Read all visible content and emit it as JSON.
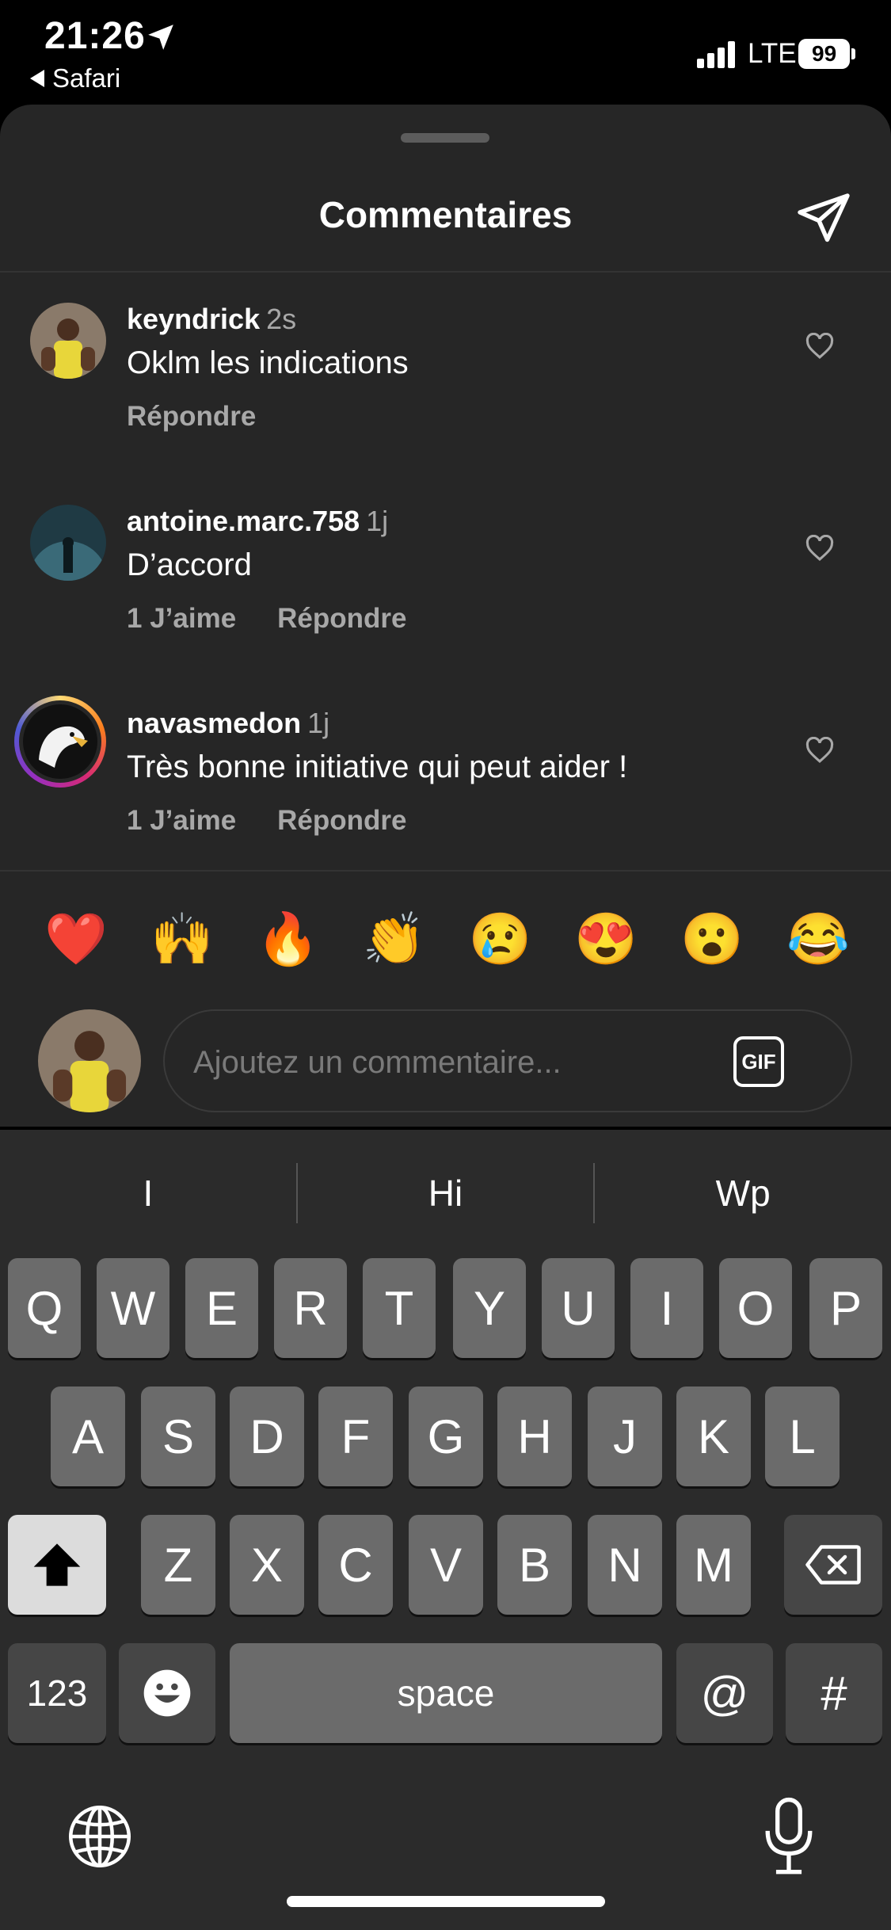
{
  "status_bar": {
    "time": "21:26",
    "back_app": "Safari",
    "network": "LTE",
    "battery": "99"
  },
  "sheet": {
    "title": "Commentaires"
  },
  "comments": [
    {
      "username": "keyndrick",
      "time": "2s",
      "text": "Oklm les indications",
      "likes": "",
      "reply": "Répondre"
    },
    {
      "username": "antoine.marc.758",
      "time": "1j",
      "text": "D’accord",
      "likes": "1 J’aime",
      "reply": "Répondre"
    },
    {
      "username": "navasmedon",
      "time": "1j",
      "text": "Très bonne initiative qui peut aider !",
      "likes": "1 J’aime",
      "reply": "Répondre"
    }
  ],
  "emoji_reactions": [
    "❤️",
    "🙌",
    "🔥",
    "👏",
    "😢",
    "😍",
    "😮",
    "😂"
  ],
  "composer": {
    "placeholder": "Ajoutez un commentaire...",
    "gif_label": "GIF"
  },
  "keyboard": {
    "suggestions": [
      "I",
      "Hi",
      "Wp"
    ],
    "row1": [
      "Q",
      "W",
      "E",
      "R",
      "T",
      "Y",
      "U",
      "I",
      "O",
      "P"
    ],
    "row2": [
      "A",
      "S",
      "D",
      "F",
      "G",
      "H",
      "J",
      "K",
      "L"
    ],
    "row3": [
      "Z",
      "X",
      "C",
      "V",
      "B",
      "N",
      "M"
    ],
    "numbers_key": "123",
    "space_key": "space",
    "at_key": "@",
    "hash_key": "#"
  },
  "colors": {
    "sheet_bg": "#262626",
    "muted_text": "#a8a8a8",
    "key_bg": "#6b6b6b",
    "keyboard_bg": "#2b2b2b",
    "story_ring": "#e1306c"
  }
}
